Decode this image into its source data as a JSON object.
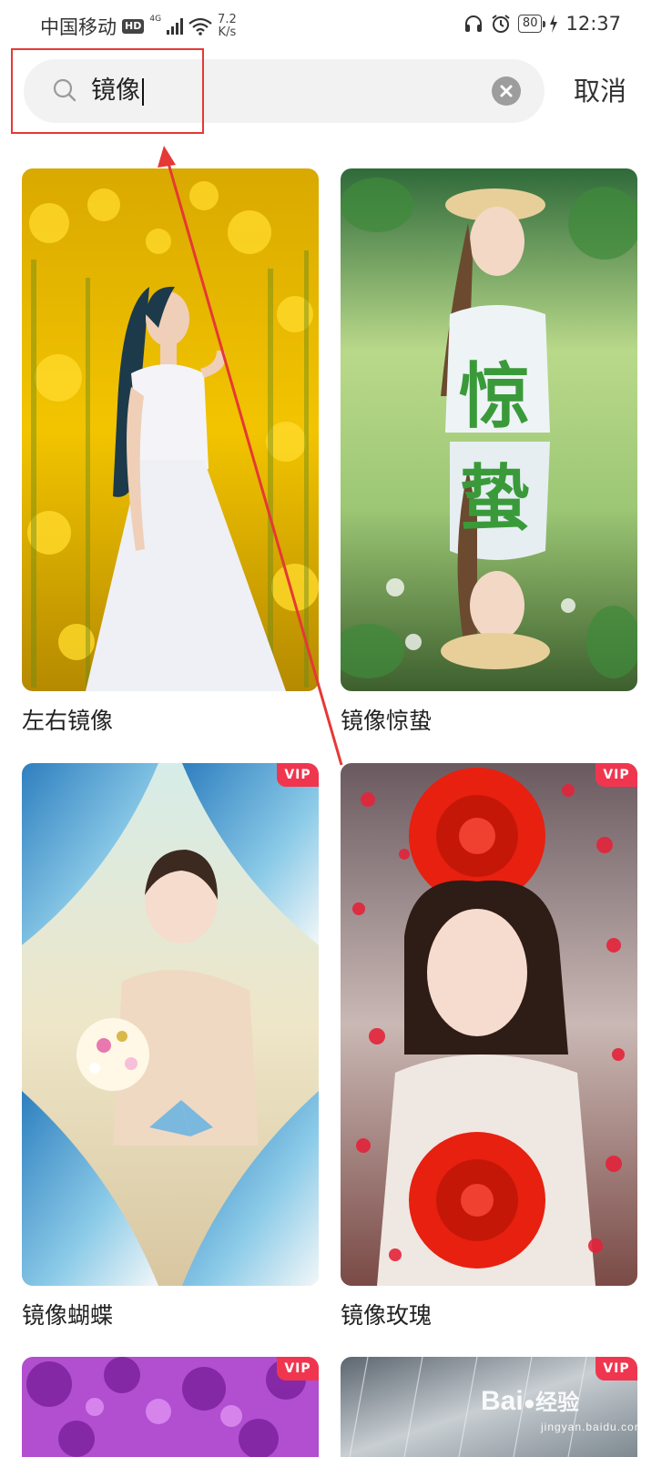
{
  "status_bar": {
    "carrier": "中国移动",
    "hd_badge": "HD",
    "network_type": "4G",
    "speed_value": "7.2",
    "speed_unit": "K/s",
    "battery": "80",
    "time": "12:37",
    "icons": [
      "headphone-icon",
      "alarm-icon",
      "charging-icon",
      "wifi-icon",
      "signal-icon"
    ]
  },
  "search": {
    "value": "镜像",
    "cancel_label": "取消"
  },
  "results": [
    {
      "title": "左右镜像",
      "vip": false
    },
    {
      "title": "镜像惊蛰",
      "vip": false,
      "overlay_text": [
        "惊",
        "蛰"
      ]
    },
    {
      "title": "镜像蝴蝶",
      "vip": true,
      "badge": "VIP"
    },
    {
      "title": "镜像玫瑰",
      "vip": true,
      "badge": "VIP"
    },
    {
      "title": "",
      "vip": true,
      "badge": "VIP"
    },
    {
      "title": "",
      "vip": true,
      "badge": "VIP"
    }
  ],
  "watermark": {
    "brand": "Bai",
    "brand_cn": "经验",
    "url": "jingyan.baidu.com"
  },
  "colors": {
    "annotation": "#e53935",
    "vip": "#f0364f"
  }
}
